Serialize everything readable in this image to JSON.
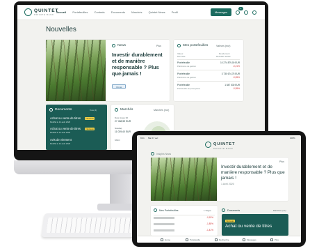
{
  "desktop": {
    "logo": {
      "name": "QUINTET",
      "sub": "PRIVATE BANK"
    },
    "nav": [
      "Accueil",
      "Portefeuilles",
      "Contrats",
      "Documents",
      "Marchés",
      "Quintet News",
      "Profil"
    ],
    "nav_active": 0,
    "messages_label": "Messages",
    "notification_count": "2",
    "page_title": "Nouvelles",
    "news": {
      "label": "News",
      "more": "Plus",
      "headline": "Investir durablement et de manière responsable ? Plus que jamais !",
      "date": "23.03.2020",
      "tag": "Climat"
    },
    "portfolios": {
      "label": "Mes portefeuilles",
      "selector": "Valeurs (eur)",
      "col_left": "Valeur",
      "col_right": "Rendement",
      "col_left_sub": "Monnaie",
      "col_right_sub": "Résultat réalisé",
      "rows": [
        {
          "name": "Portefeuille",
          "sub": "Patrimoine de gestion",
          "amount": "10 274 879,00 EUR",
          "change": "-0,21%"
        },
        {
          "name": "Portefeuille",
          "sub": "Patrimoine de gestion",
          "amount": "3 730 674,75 EUR",
          "change": "-0,05%"
        },
        {
          "name": "Portefeuille",
          "sub": "Portefeuille de prévoyance",
          "amount": "1 847 530 EUR",
          "change": "-0,95%"
        }
      ]
    },
    "documents": {
      "label": "Documents",
      "more": "Tous (4)",
      "items": [
        {
          "title": "Achat ou vente de titres",
          "tag": "Nouveau",
          "sub": "Modifié le 14 août 2020"
        },
        {
          "title": "Achat ou vente de titres",
          "tag": "Nouveau",
          "sub": "Modifié le 14 août 2020"
        },
        {
          "title": "Avis de virement",
          "tag": "",
          "sub": "Modifié le 14 août 2020"
        }
      ]
    },
    "markets": {
      "label": "Marchés",
      "more": "Marchés (eur)",
      "items": [
        {
          "name": "Dow Jones 30",
          "value": "27 458,59 EUR"
        },
        {
          "name": "Nasdaq",
          "value": "11 039,40 EUR"
        },
        {
          "name": "MSCI",
          "value": ""
        }
      ]
    }
  },
  "tablet": {
    "status_time": "9:41",
    "status_date": "Mar 17 avr.",
    "status_battery": "100%",
    "logo": {
      "name": "QUINTET",
      "sub": "PRIVATE BANK"
    },
    "section_label": "Insights News",
    "headline": "Investir durablement et de manière responsable ? Plus que jamais !",
    "date": "1 Avril 2020",
    "more": "Plus",
    "portfolios_label": "Mes Portefeuilles",
    "portfolios_selector": "1 Vague",
    "portfolio_rows": [
      {
        "change": "-0,15%"
      },
      {
        "change": "-1,85%"
      },
      {
        "change": "-1,41%"
      }
    ],
    "documents_label": "Documents",
    "documents_more": "Marchés (eur)",
    "document_tag": "Nouveau",
    "document_title": "Achat ou vente de titres",
    "tabs": [
      "Home",
      "Portefeuille",
      "Recherche",
      "Messages",
      "Plus"
    ]
  },
  "colors": {
    "brand": "#1b6b5f",
    "brand_dark": "#1b5c55",
    "negative": "#d23a3a",
    "tag": "#f2d24a"
  }
}
